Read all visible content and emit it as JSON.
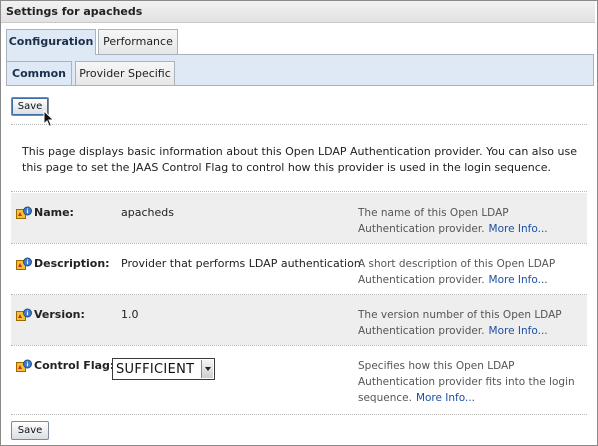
{
  "window": {
    "title": "Settings for apacheds"
  },
  "tabs": {
    "outer": [
      {
        "label": "Configuration",
        "active": true
      },
      {
        "label": "Performance",
        "active": false
      }
    ],
    "inner": [
      {
        "label": "Common",
        "active": true
      },
      {
        "label": "Provider Specific",
        "active": false
      }
    ]
  },
  "buttons": {
    "save_top": "Save",
    "save_bottom": "Save"
  },
  "intro": "This page displays basic information about this Open LDAP Authentication provider. You can also use this page to set the JAAS Control Flag to control how this provider is used in the login sequence.",
  "fields": [
    {
      "label": "Name:",
      "value": "apacheds",
      "help": "The name of this Open LDAP Authentication provider.",
      "more": "More Info..."
    },
    {
      "label": "Description:",
      "value": "Provider that performs LDAP authentication",
      "help": "A short description of this Open LDAP Authentication provider.",
      "more": "More Info..."
    },
    {
      "label": "Version:",
      "value": "1.0",
      "help": "The version number of this Open LDAP Authentication provider.",
      "more": "More Info..."
    },
    {
      "label": "Control Flag:",
      "value": "SUFFICIENT",
      "help": "Specifies how this Open LDAP Authentication provider fits into the login sequence.",
      "more": "More Info..."
    }
  ],
  "colors": {
    "tab_active_bg": "#dfe9f5",
    "link": "#1d4fa3",
    "row_shade": "#eeeeee"
  },
  "icons": {
    "field_icon": "info-lock-icon",
    "cursor": "pointer-cursor-icon"
  }
}
